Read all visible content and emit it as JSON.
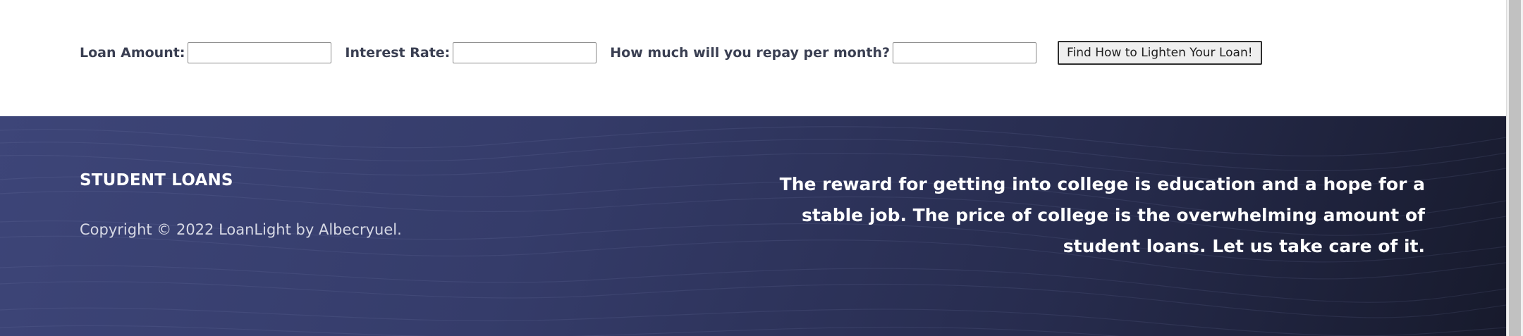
{
  "calculator": {
    "loan_amount_label": "Loan Amount:",
    "loan_amount_value": "",
    "interest_rate_label": "Interest Rate:",
    "interest_rate_value": "",
    "monthly_repay_label": "How much will you repay per month?",
    "monthly_repay_value": "",
    "submit_label": "Find How to Lighten Your Loan!"
  },
  "footer": {
    "title": "STUDENT LOANS",
    "copyright": "Copyright © 2022 LoanLight by Albecryuel.",
    "tagline": "The reward for getting into college is education and a hope for a stable job. The price of college is the overwhelming amount of student loans. Let us take care of it."
  },
  "colors": {
    "footer_gradient_start": "#3d4578",
    "footer_gradient_end": "#171a2c",
    "label_text": "#3a3f52",
    "footer_text": "#ffffff"
  }
}
